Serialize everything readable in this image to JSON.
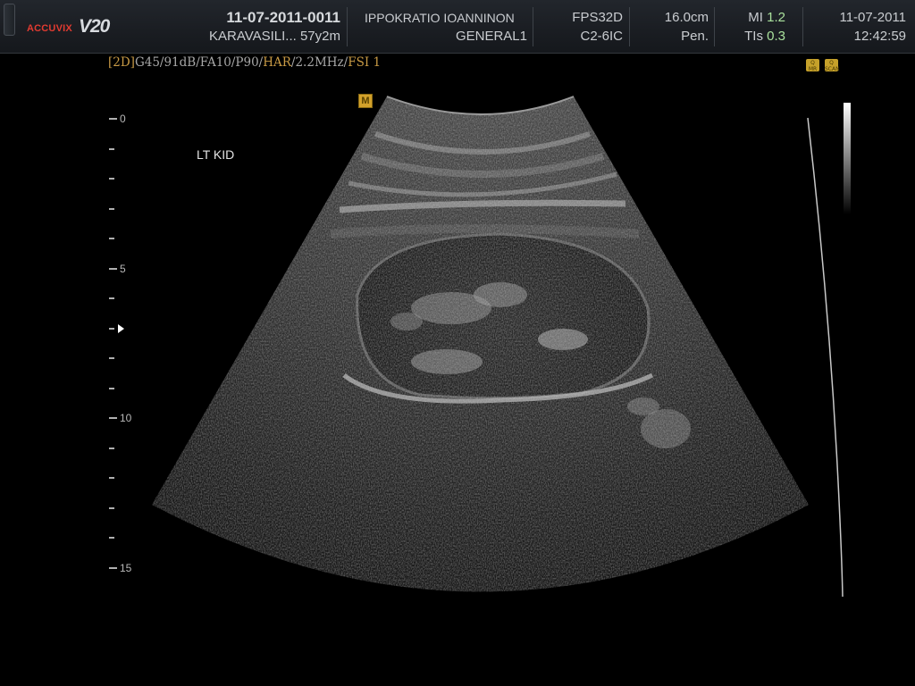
{
  "header": {
    "brand": "ACCUVIX",
    "model": "V20",
    "patient_id": "11-07-2011-0011",
    "patient_name_age": "KARAVASILI... 57y2m",
    "institution": "IPPOKRATIO IOANNINON",
    "preset": "GENERAL1",
    "frame_rate": "FPS32D",
    "probe": "C2-6IC",
    "depth": "16.0cm",
    "application": "Pen.",
    "mi_label": "MI",
    "mi_value": "1.2",
    "tis_label": "TIs",
    "tis_value": "0.3",
    "date": "11-07-2011",
    "time": "12:42:59"
  },
  "params": {
    "mode": "[2D]",
    "settings": "G45/91dB/FA10/P90/",
    "harmonic": "HAR",
    "freq": "/2.2MHz/",
    "fsi": "FSI 1"
  },
  "icons": {
    "right_icon_1": "Q MR",
    "right_icon_2": "Q SCAN",
    "marker": "M"
  },
  "annotation": "LT KID",
  "depth_scale": {
    "unit": "cm",
    "max": 16,
    "labels": [
      "0",
      "5",
      "10",
      "15"
    ],
    "focus_depth": 7
  },
  "colors": {
    "header_bg": "#1c1f24",
    "brand_red": "#e23b31",
    "param_orange": "#c89a45",
    "param_grey": "#a7a7a7",
    "value_green": "#a9e09c",
    "marker_yellow": "#d2a12b"
  }
}
